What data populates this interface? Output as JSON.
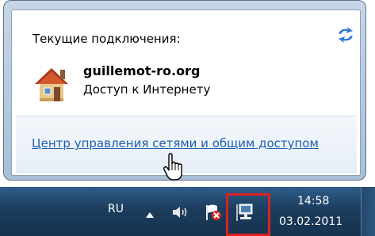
{
  "flyout": {
    "current_label": "Текущие подключения:",
    "network_name": "guillemot-ro.org",
    "network_access": "Доступ к Интернету",
    "center_link": "Центр управления сетями и общим доступом"
  },
  "taskbar": {
    "language": "RU",
    "time": "14:58",
    "date": "03.02.2011"
  },
  "icons": {
    "refresh": "refresh-icon",
    "network": "house-network-icon",
    "cursor": "hand-pointer-icon",
    "up_arrow": "up-arrow-icon",
    "volume": "volume-icon",
    "action_center": "flag-error-icon",
    "network_tray": "network-icon"
  },
  "colors": {
    "link": "#1f5fb0",
    "highlight": "#e02020"
  }
}
